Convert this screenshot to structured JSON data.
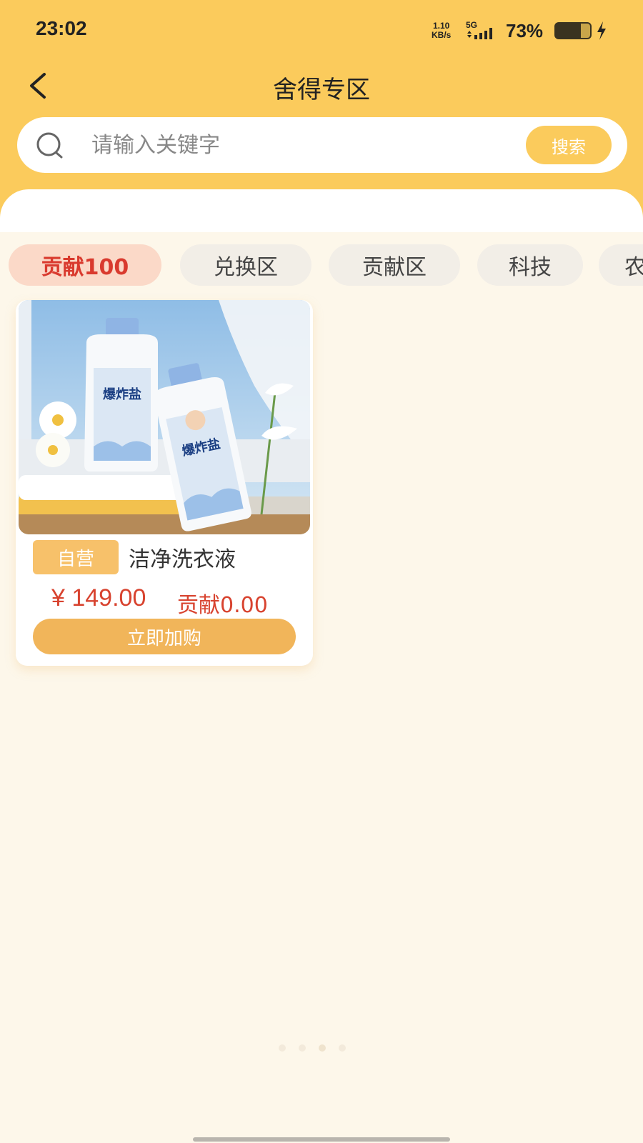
{
  "status_bar": {
    "time": "23:02",
    "net_speed_value": "1.10",
    "net_speed_unit": "KB/s",
    "network_type": "5G",
    "battery_percent": "73%",
    "battery_level": 0.73
  },
  "header": {
    "title": "舍得专区"
  },
  "search": {
    "placeholder": "请输入关键字",
    "button_label": "搜索"
  },
  "tabs": [
    {
      "label": "贡献100",
      "active": true
    },
    {
      "label": "兑换区",
      "active": false
    },
    {
      "label": "贡献区",
      "active": false
    },
    {
      "label": "科技",
      "active": false
    },
    {
      "label": "农",
      "active": false
    }
  ],
  "products": [
    {
      "badge": "自营",
      "name": "洁净洗衣液",
      "price": "¥ 149.00",
      "contribution": "贡献0.00",
      "action_label": "立即加购",
      "image_text": "爆炸盐"
    }
  ],
  "colors": {
    "brand": "#fbcb5c",
    "background": "#fdf7ea",
    "price": "#d8432f",
    "active_tab_text": "#d93a2e",
    "button": "#f1b55a"
  }
}
